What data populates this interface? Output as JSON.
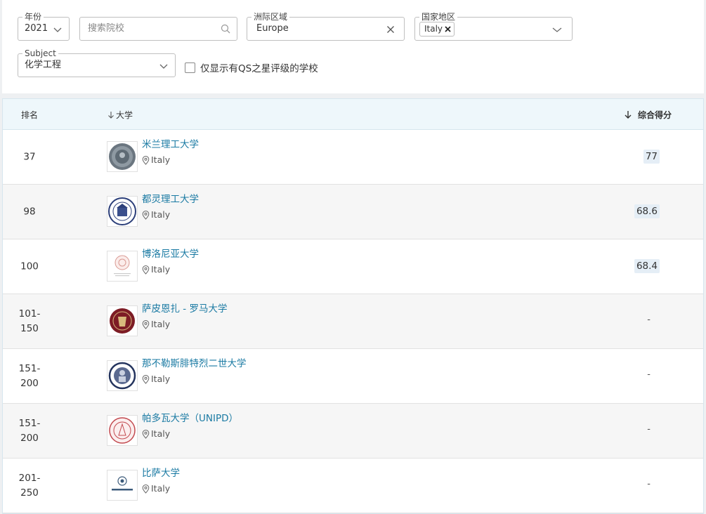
{
  "filters": {
    "year": {
      "label": "年份",
      "value": "2021"
    },
    "search": {
      "placeholder": "搜索院校"
    },
    "region": {
      "label": "洲际区域",
      "value": "Europe"
    },
    "country": {
      "label": "国家地区",
      "tag": "Italy"
    },
    "subject": {
      "label": "Subject",
      "value": "化学工程"
    },
    "qs_stars_checkbox": {
      "label": "仅显示有QS之星评级的学校",
      "checked": false
    }
  },
  "table": {
    "headers": {
      "rank": "排名",
      "university": "大学",
      "score": "综合得分"
    },
    "rows": [
      {
        "rank": "37",
        "name": "米兰理工大学",
        "country": "Italy",
        "score": "77",
        "logo": "polimi-seal"
      },
      {
        "rank": "98",
        "name": "都灵理工大学",
        "country": "Italy",
        "score": "68.6",
        "logo": "polito-seal"
      },
      {
        "rank": "100",
        "name": "博洛尼亚大学",
        "country": "Italy",
        "score": "68.4",
        "logo": "unibo-seal"
      },
      {
        "rank_line1": "101-",
        "rank_line2": "150",
        "name": "萨皮恩扎 - 罗马大学",
        "country": "Italy",
        "score": "-",
        "logo": "sapienza-seal"
      },
      {
        "rank_line1": "151-",
        "rank_line2": "200",
        "name": "那不勒斯腓特烈二世大学",
        "country": "Italy",
        "score": "-",
        "logo": "unina-seal"
      },
      {
        "rank_line1": "151-",
        "rank_line2": "200",
        "name": "帕多瓦大学（UNIPD）",
        "country": "Italy",
        "score": "-",
        "logo": "unipd-seal"
      },
      {
        "rank_line1": "201-",
        "rank_line2": "250",
        "name": "比萨大学",
        "country": "Italy",
        "score": "-",
        "logo": "unipi-seal"
      }
    ]
  },
  "colors": {
    "link": "#1a7aa3",
    "header_bg": "#eef7fb",
    "score_bg": "#e5eef6"
  }
}
